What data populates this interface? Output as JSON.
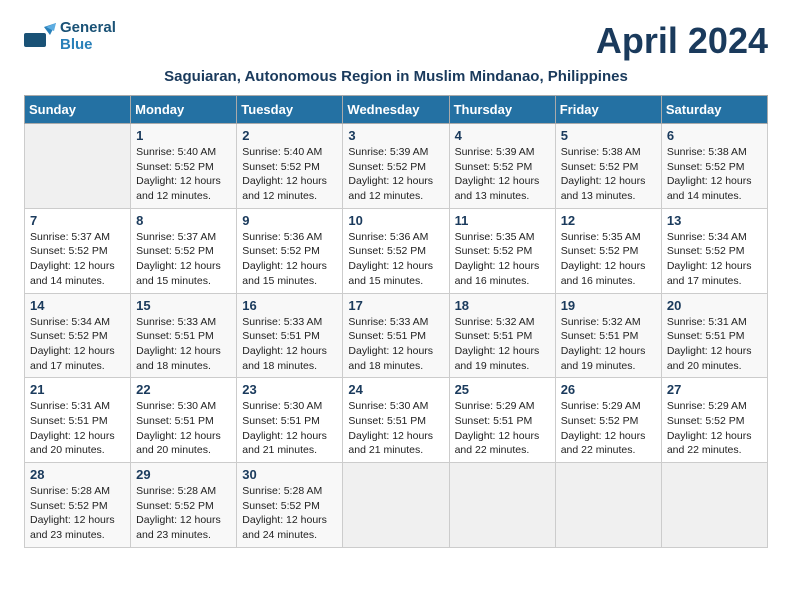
{
  "header": {
    "logo_line1": "General",
    "logo_line2": "Blue",
    "title": "April 2024",
    "subtitle": "Saguiaran, Autonomous Region in Muslim Mindanao, Philippines"
  },
  "weekdays": [
    "Sunday",
    "Monday",
    "Tuesday",
    "Wednesday",
    "Thursday",
    "Friday",
    "Saturday"
  ],
  "weeks": [
    [
      {
        "day": "",
        "info": ""
      },
      {
        "day": "1",
        "info": "Sunrise: 5:40 AM\nSunset: 5:52 PM\nDaylight: 12 hours\nand 12 minutes."
      },
      {
        "day": "2",
        "info": "Sunrise: 5:40 AM\nSunset: 5:52 PM\nDaylight: 12 hours\nand 12 minutes."
      },
      {
        "day": "3",
        "info": "Sunrise: 5:39 AM\nSunset: 5:52 PM\nDaylight: 12 hours\nand 12 minutes."
      },
      {
        "day": "4",
        "info": "Sunrise: 5:39 AM\nSunset: 5:52 PM\nDaylight: 12 hours\nand 13 minutes."
      },
      {
        "day": "5",
        "info": "Sunrise: 5:38 AM\nSunset: 5:52 PM\nDaylight: 12 hours\nand 13 minutes."
      },
      {
        "day": "6",
        "info": "Sunrise: 5:38 AM\nSunset: 5:52 PM\nDaylight: 12 hours\nand 14 minutes."
      }
    ],
    [
      {
        "day": "7",
        "info": "Sunrise: 5:37 AM\nSunset: 5:52 PM\nDaylight: 12 hours\nand 14 minutes."
      },
      {
        "day": "8",
        "info": "Sunrise: 5:37 AM\nSunset: 5:52 PM\nDaylight: 12 hours\nand 15 minutes."
      },
      {
        "day": "9",
        "info": "Sunrise: 5:36 AM\nSunset: 5:52 PM\nDaylight: 12 hours\nand 15 minutes."
      },
      {
        "day": "10",
        "info": "Sunrise: 5:36 AM\nSunset: 5:52 PM\nDaylight: 12 hours\nand 15 minutes."
      },
      {
        "day": "11",
        "info": "Sunrise: 5:35 AM\nSunset: 5:52 PM\nDaylight: 12 hours\nand 16 minutes."
      },
      {
        "day": "12",
        "info": "Sunrise: 5:35 AM\nSunset: 5:52 PM\nDaylight: 12 hours\nand 16 minutes."
      },
      {
        "day": "13",
        "info": "Sunrise: 5:34 AM\nSunset: 5:52 PM\nDaylight: 12 hours\nand 17 minutes."
      }
    ],
    [
      {
        "day": "14",
        "info": "Sunrise: 5:34 AM\nSunset: 5:52 PM\nDaylight: 12 hours\nand 17 minutes."
      },
      {
        "day": "15",
        "info": "Sunrise: 5:33 AM\nSunset: 5:51 PM\nDaylight: 12 hours\nand 18 minutes."
      },
      {
        "day": "16",
        "info": "Sunrise: 5:33 AM\nSunset: 5:51 PM\nDaylight: 12 hours\nand 18 minutes."
      },
      {
        "day": "17",
        "info": "Sunrise: 5:33 AM\nSunset: 5:51 PM\nDaylight: 12 hours\nand 18 minutes."
      },
      {
        "day": "18",
        "info": "Sunrise: 5:32 AM\nSunset: 5:51 PM\nDaylight: 12 hours\nand 19 minutes."
      },
      {
        "day": "19",
        "info": "Sunrise: 5:32 AM\nSunset: 5:51 PM\nDaylight: 12 hours\nand 19 minutes."
      },
      {
        "day": "20",
        "info": "Sunrise: 5:31 AM\nSunset: 5:51 PM\nDaylight: 12 hours\nand 20 minutes."
      }
    ],
    [
      {
        "day": "21",
        "info": "Sunrise: 5:31 AM\nSunset: 5:51 PM\nDaylight: 12 hours\nand 20 minutes."
      },
      {
        "day": "22",
        "info": "Sunrise: 5:30 AM\nSunset: 5:51 PM\nDaylight: 12 hours\nand 20 minutes."
      },
      {
        "day": "23",
        "info": "Sunrise: 5:30 AM\nSunset: 5:51 PM\nDaylight: 12 hours\nand 21 minutes."
      },
      {
        "day": "24",
        "info": "Sunrise: 5:30 AM\nSunset: 5:51 PM\nDaylight: 12 hours\nand 21 minutes."
      },
      {
        "day": "25",
        "info": "Sunrise: 5:29 AM\nSunset: 5:51 PM\nDaylight: 12 hours\nand 22 minutes."
      },
      {
        "day": "26",
        "info": "Sunrise: 5:29 AM\nSunset: 5:52 PM\nDaylight: 12 hours\nand 22 minutes."
      },
      {
        "day": "27",
        "info": "Sunrise: 5:29 AM\nSunset: 5:52 PM\nDaylight: 12 hours\nand 22 minutes."
      }
    ],
    [
      {
        "day": "28",
        "info": "Sunrise: 5:28 AM\nSunset: 5:52 PM\nDaylight: 12 hours\nand 23 minutes."
      },
      {
        "day": "29",
        "info": "Sunrise: 5:28 AM\nSunset: 5:52 PM\nDaylight: 12 hours\nand 23 minutes."
      },
      {
        "day": "30",
        "info": "Sunrise: 5:28 AM\nSunset: 5:52 PM\nDaylight: 12 hours\nand 24 minutes."
      },
      {
        "day": "",
        "info": ""
      },
      {
        "day": "",
        "info": ""
      },
      {
        "day": "",
        "info": ""
      },
      {
        "day": "",
        "info": ""
      }
    ]
  ]
}
